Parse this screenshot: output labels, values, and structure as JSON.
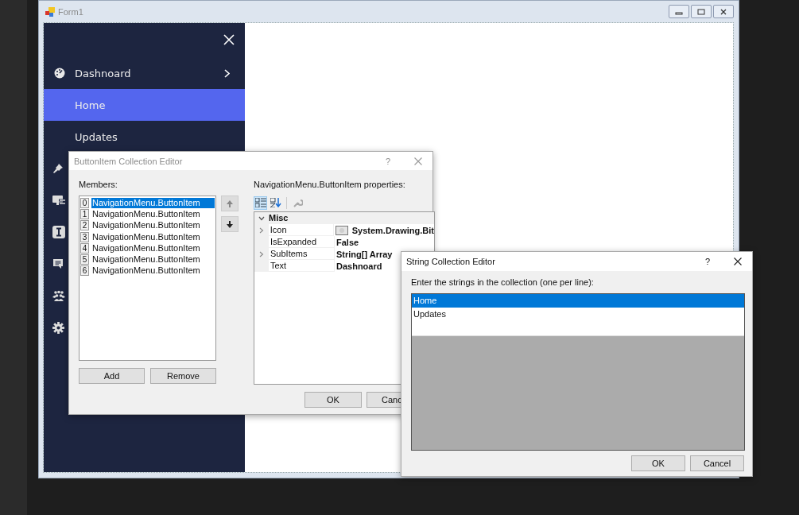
{
  "window": {
    "title": "Form1"
  },
  "nav": {
    "items": [
      {
        "label": "Dashnoard",
        "selected": false,
        "has_submenu": true
      },
      {
        "label": "Home",
        "selected": true,
        "has_submenu": false
      },
      {
        "label": "Updates",
        "selected": false,
        "has_submenu": false
      }
    ]
  },
  "collection_editor": {
    "title": "ButtonItem Collection Editor",
    "help": "?",
    "members_label": "Members:",
    "members": [
      {
        "index": "0",
        "label": "NavigationMenu.ButtonItem",
        "selected": true
      },
      {
        "index": "1",
        "label": "NavigationMenu.ButtonItem",
        "selected": false
      },
      {
        "index": "2",
        "label": "NavigationMenu.ButtonItem",
        "selected": false
      },
      {
        "index": "3",
        "label": "NavigationMenu.ButtonItem",
        "selected": false
      },
      {
        "index": "4",
        "label": "NavigationMenu.ButtonItem",
        "selected": false
      },
      {
        "index": "5",
        "label": "NavigationMenu.ButtonItem",
        "selected": false
      },
      {
        "index": "6",
        "label": "NavigationMenu.ButtonItem",
        "selected": false
      }
    ],
    "add_button": "Add",
    "remove_button": "Remove",
    "properties_label": "NavigationMenu.ButtonItem properties:",
    "category": {
      "label": "Misc",
      "expanded": true
    },
    "properties": [
      {
        "name": "Icon",
        "value": "System.Drawing.Bit",
        "expandable": true,
        "kind": "image"
      },
      {
        "name": "IsExpanded",
        "value": "False",
        "expandable": false,
        "kind": "text"
      },
      {
        "name": "SubItems",
        "value": "String[] Array",
        "expandable": true,
        "kind": "text"
      },
      {
        "name": "Text",
        "value": "Dashnoard",
        "expandable": false,
        "kind": "text"
      }
    ],
    "ok_button": "OK",
    "cancel_button": "Canc"
  },
  "string_editor": {
    "title": "String Collection Editor",
    "help": "?",
    "prompt": "Enter the strings in the collection (one per line):",
    "lines": [
      {
        "text": "Home",
        "selected": true
      },
      {
        "text": "Updates",
        "selected": false
      }
    ],
    "ok_button": "OK",
    "cancel_button": "Cancel"
  }
}
